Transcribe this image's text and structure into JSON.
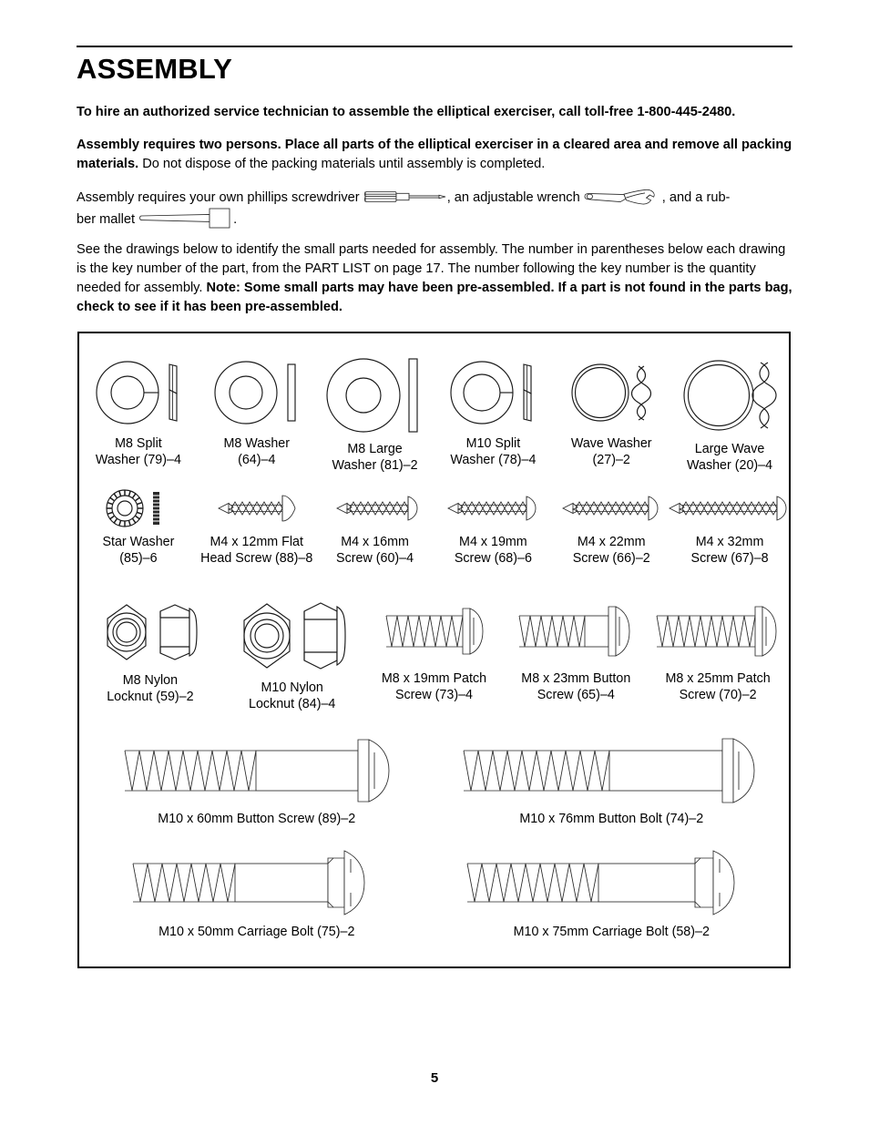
{
  "document": {
    "title": "ASSEMBLY",
    "page_number": "5"
  },
  "paragraphs": {
    "hire_technician": "To hire an authorized service technician to assemble the elliptical exerciser, call toll-free 1-800-445-2480.",
    "two_persons_bold": "Assembly requires two persons. Place all parts of the elliptical exerciser in a cleared area and remove all packing materials.",
    "two_persons_rest": " Do not dispose of the packing materials until assembly is completed.",
    "tools_part1": "Assembly requires your own phillips screwdriver ",
    "tools_part2": ", an adjustable wrench ",
    "tools_part3": ", and a rub-",
    "tools_part4": "ber mallet ",
    "tools_part5": ".",
    "drawings_intro": "See the drawings below to identify the small parts needed for assembly. The number in parentheses below each drawing is the key number of the part, from the PART LIST on page 17. The number following the key number is the quantity needed for assembly. ",
    "drawings_note_bold": "Note: Some small parts may have been pre-assembled. If a part is not found in the parts bag, check to see if it has been pre-assembled."
  },
  "tool_icons": {
    "screwdriver": "screwdriver-icon",
    "wrench": "adjustable-wrench-icon",
    "mallet": "rubber-mallet-icon"
  },
  "parts": {
    "row1": [
      {
        "icon": "m8-split-washer",
        "caption": "M8 Split\nWasher (79)–4",
        "name": "M8 Split Washer",
        "key": "79",
        "qty": "4"
      },
      {
        "icon": "m8-washer",
        "caption": "M8 Washer\n(64)–4",
        "name": "M8 Washer",
        "key": "64",
        "qty": "4"
      },
      {
        "icon": "m8-large-washer",
        "caption": "M8 Large\nWasher (81)–2",
        "name": "M8 Large Washer",
        "key": "81",
        "qty": "2"
      },
      {
        "icon": "m10-split-washer",
        "caption": "M10 Split\nWasher (78)–4",
        "name": "M10 Split Washer",
        "key": "78",
        "qty": "4"
      },
      {
        "icon": "wave-washer",
        "caption": "Wave Washer\n(27)–2",
        "name": "Wave Washer",
        "key": "27",
        "qty": "2"
      },
      {
        "icon": "large-wave-washer",
        "caption": "Large Wave\nWasher (20)–4",
        "name": "Large Wave Washer",
        "key": "20",
        "qty": "4"
      }
    ],
    "row2": [
      {
        "icon": "star-washer",
        "caption": "Star Washer\n(85)–6",
        "name": "Star Washer",
        "key": "85",
        "qty": "6"
      },
      {
        "icon": "m4-12mm-flat-head-screw",
        "caption": "M4 x 12mm Flat\nHead Screw (88)–8",
        "name": "M4 x 12mm Flat Head Screw",
        "key": "88",
        "qty": "8"
      },
      {
        "icon": "m4-16mm-screw",
        "caption": "M4 x 16mm\nScrew (60)–4",
        "name": "M4 x 16mm Screw",
        "key": "60",
        "qty": "4"
      },
      {
        "icon": "m4-19mm-screw",
        "caption": "M4 x 19mm\nScrew (68)–6",
        "name": "M4 x 19mm Screw",
        "key": "68",
        "qty": "6"
      },
      {
        "icon": "m4-22mm-screw",
        "caption": "M4 x 22mm\nScrew (66)–2",
        "name": "M4 x 22mm Screw",
        "key": "66",
        "qty": "2"
      },
      {
        "icon": "m4-32mm-screw",
        "caption": "M4 x 32mm\nScrew (67)–8",
        "name": "M4 x 32mm Screw",
        "key": "67",
        "qty": "8"
      }
    ],
    "row3": [
      {
        "icon": "m8-nylon-locknut",
        "caption": "M8 Nylon\nLocknut (59)–2",
        "name": "M8 Nylon Locknut",
        "key": "59",
        "qty": "2"
      },
      {
        "icon": "m10-nylon-locknut",
        "caption": "M10 Nylon\nLocknut (84)–4",
        "name": "M10 Nylon Locknut",
        "key": "84",
        "qty": "4"
      },
      {
        "icon": "m8-19mm-patch-screw",
        "caption": "M8 x 19mm Patch\nScrew (73)–4",
        "name": "M8 x 19mm Patch Screw",
        "key": "73",
        "qty": "4"
      },
      {
        "icon": "m8-23mm-button-screw",
        "caption": "M8 x 23mm Button\nScrew (65)–4",
        "name": "M8 x 23mm Button Screw",
        "key": "65",
        "qty": "4"
      },
      {
        "icon": "m8-25mm-patch-screw",
        "caption": "M8 x 25mm Patch\nScrew (70)–2",
        "name": "M8 x 25mm Patch Screw",
        "key": "70",
        "qty": "2"
      }
    ],
    "row4": [
      {
        "icon": "m10-60mm-button-screw",
        "caption": "M10 x 60mm Button Screw (89)–2",
        "name": "M10 x 60mm Button Screw",
        "key": "89",
        "qty": "2"
      },
      {
        "icon": "m10-76mm-button-bolt",
        "caption": "M10 x 76mm Button Bolt (74)–2",
        "name": "M10 x 76mm Button Bolt",
        "key": "74",
        "qty": "2"
      }
    ],
    "row5": [
      {
        "icon": "m10-50mm-carriage-bolt",
        "caption": "M10 x 50mm Carriage Bolt (75)–2",
        "name": "M10 x 50mm Carriage Bolt",
        "key": "75",
        "qty": "2"
      },
      {
        "icon": "m10-75mm-carriage-bolt",
        "caption": "M10 x 75mm Carriage Bolt (58)–2",
        "name": "M10 x 75mm Carriage Bolt",
        "key": "58",
        "qty": "2"
      }
    ]
  },
  "colors": {
    "ink": "#000000",
    "line_art": "#1a1a1a",
    "paper": "#ffffff"
  }
}
